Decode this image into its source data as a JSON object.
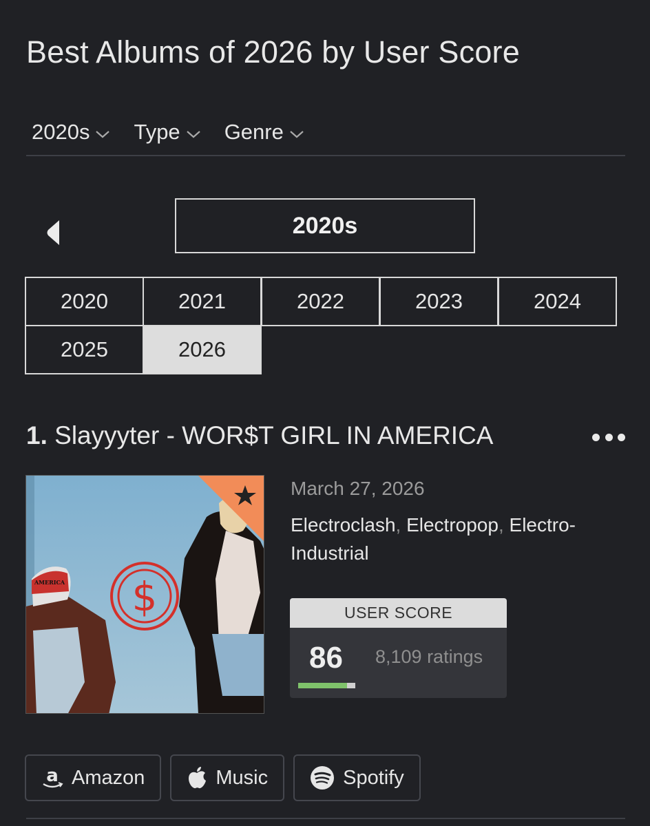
{
  "page": {
    "title": "Best Albums of 2026 by User Score"
  },
  "filters": [
    {
      "label": "2020s",
      "icon": "chevron-down-icon"
    },
    {
      "label": "Type",
      "icon": "chevron-down-icon"
    },
    {
      "label": "Genre",
      "icon": "chevron-down-icon"
    }
  ],
  "decade_nav": {
    "prev_icon": "caret-left-icon",
    "current": "2020s"
  },
  "years": [
    {
      "label": "2020",
      "selected": false
    },
    {
      "label": "2021",
      "selected": false
    },
    {
      "label": "2022",
      "selected": false
    },
    {
      "label": "2023",
      "selected": false
    },
    {
      "label": "2024",
      "selected": false
    },
    {
      "label": "2025",
      "selected": false
    },
    {
      "label": "2026",
      "selected": true
    }
  ],
  "album": {
    "rank": "1.",
    "title": "Slayyyter - WOR$T GIRL IN AMERICA",
    "release_date": "March 27, 2026",
    "genres": [
      "Electroclash",
      "Electropop",
      "Electro-Industrial"
    ],
    "genre_separator": ",",
    "cover_hat_text": "WOR$T GIRL IN AMERICA",
    "cover_symbol": "$",
    "user_score": {
      "label": "USER SCORE",
      "value": "86",
      "ratings": "8,109 ratings",
      "bar_fraction": 0.86,
      "bar_color": "#7fc26b"
    },
    "more_icon": "more-horizontal-icon"
  },
  "stream_links": [
    {
      "label": "Amazon",
      "icon": "amazon-icon"
    },
    {
      "label": "Music",
      "icon": "apple-icon"
    },
    {
      "label": "Spotify",
      "icon": "spotify-icon"
    }
  ]
}
